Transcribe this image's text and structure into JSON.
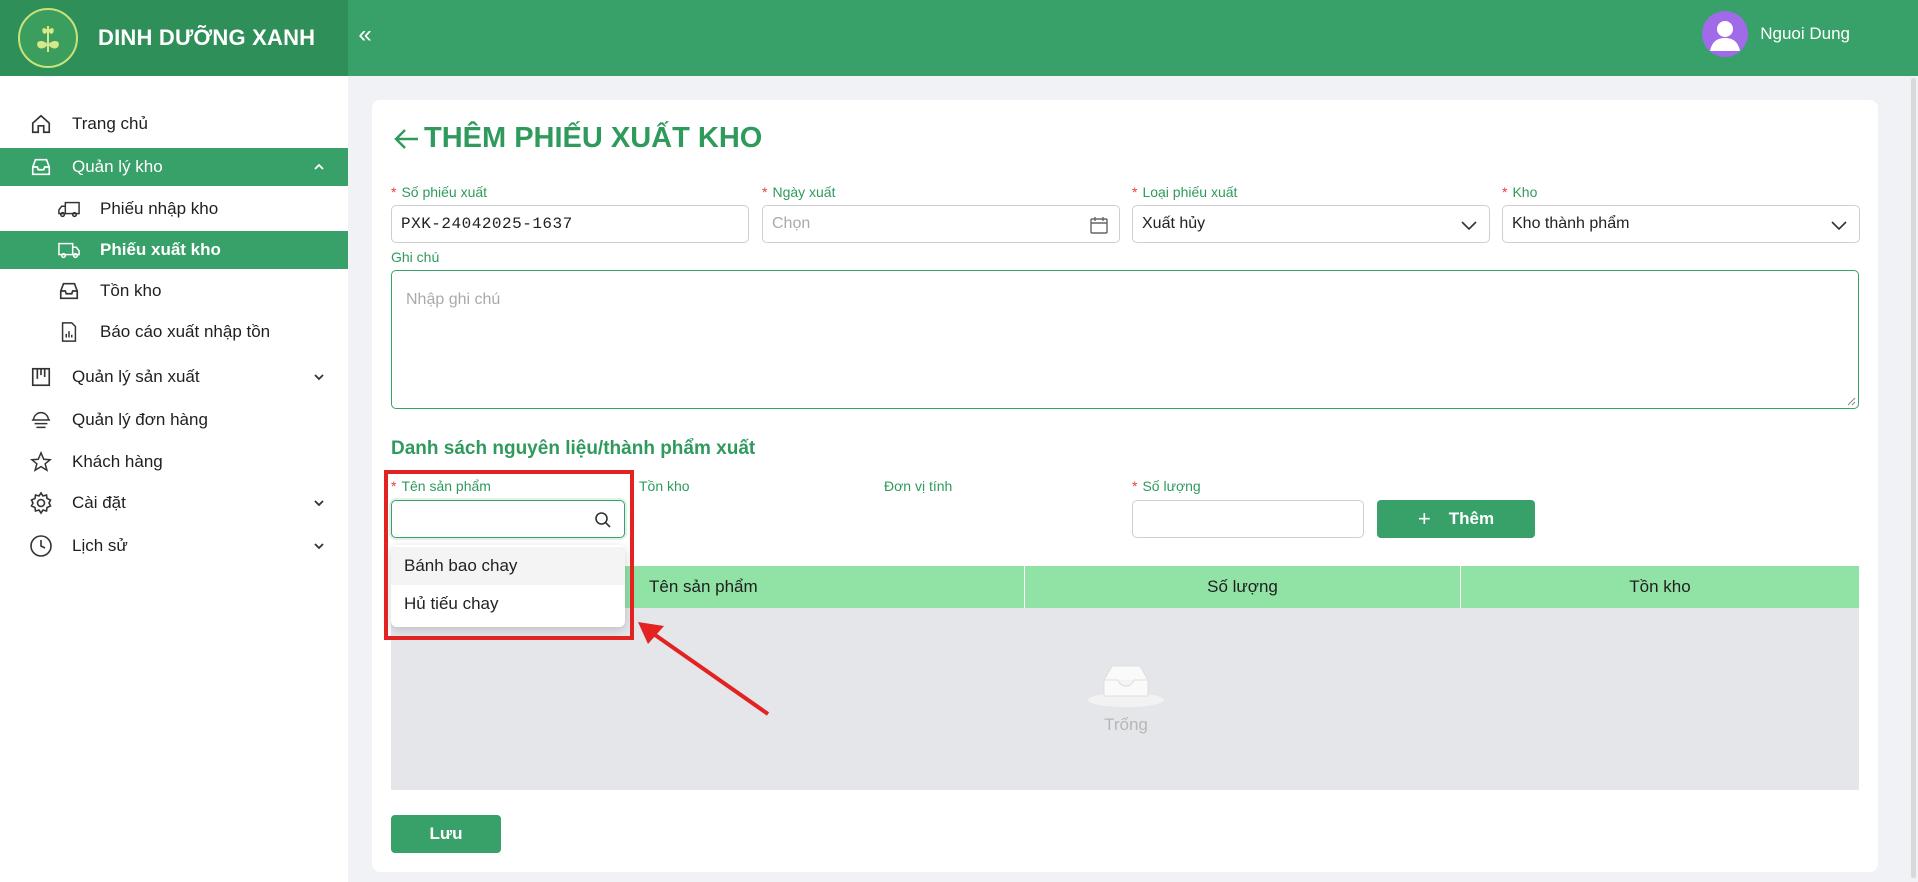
{
  "app": {
    "name": "DINH DƯỠNG XANH"
  },
  "user": {
    "name": "Nguoi Dung"
  },
  "sidebar": {
    "items": [
      {
        "label": "Trang chủ",
        "icon": "home-icon"
      },
      {
        "label": "Quản lý kho",
        "icon": "inbox-icon",
        "expanded": true
      },
      {
        "label": "Phiếu nhập kho",
        "icon": "truck-in-icon"
      },
      {
        "label": "Phiếu xuất kho",
        "icon": "truck-out-icon",
        "active": true
      },
      {
        "label": "Tồn kho",
        "icon": "inbox-icon"
      },
      {
        "label": "Báo cáo xuất nhập tồn",
        "icon": "report-icon"
      },
      {
        "label": "Quản lý sản xuất",
        "icon": "board-icon"
      },
      {
        "label": "Quản lý đơn hàng",
        "icon": "order-icon"
      },
      {
        "label": "Khách hàng",
        "icon": "star-icon"
      },
      {
        "label": "Cài đặt",
        "icon": "gear-icon"
      },
      {
        "label": "Lịch sử",
        "icon": "clock-icon"
      }
    ]
  },
  "form": {
    "title": "THÊM PHIẾU XUẤT KHO",
    "so_phieu": {
      "label": "Số phiếu xuất",
      "value": "PXK-24042025-1637"
    },
    "ngay_xuat": {
      "label": "Ngày xuất",
      "placeholder": "Chọn"
    },
    "loai_phieu": {
      "label": "Loại phiếu xuất",
      "value": "Xuất hủy"
    },
    "kho": {
      "label": "Kho",
      "value": "Kho thành phẩm"
    },
    "ghi_chu": {
      "label": "Ghi chú",
      "placeholder": "Nhập ghi chú"
    }
  },
  "items_section": {
    "title": "Danh sách nguyên liệu/thành phẩm xuất",
    "ten_sp_label": "Tên sản phẩm",
    "ton_kho_label": "Tồn kho",
    "don_vi_label": "Đơn vị tính",
    "so_luong_label": "Số lượng",
    "add_button": "Thêm",
    "dropdown_options": [
      "Bánh bao chay",
      "Hủ tiếu chay"
    ]
  },
  "table": {
    "columns": [
      "Tên sản phẩm",
      "Số lượng",
      "Tồn kho"
    ],
    "empty_text": "Trống"
  },
  "save_button": "Lưu",
  "colors": {
    "primary": "#38a169",
    "header_table": "#90e2a5",
    "annotation": "#e32222"
  }
}
